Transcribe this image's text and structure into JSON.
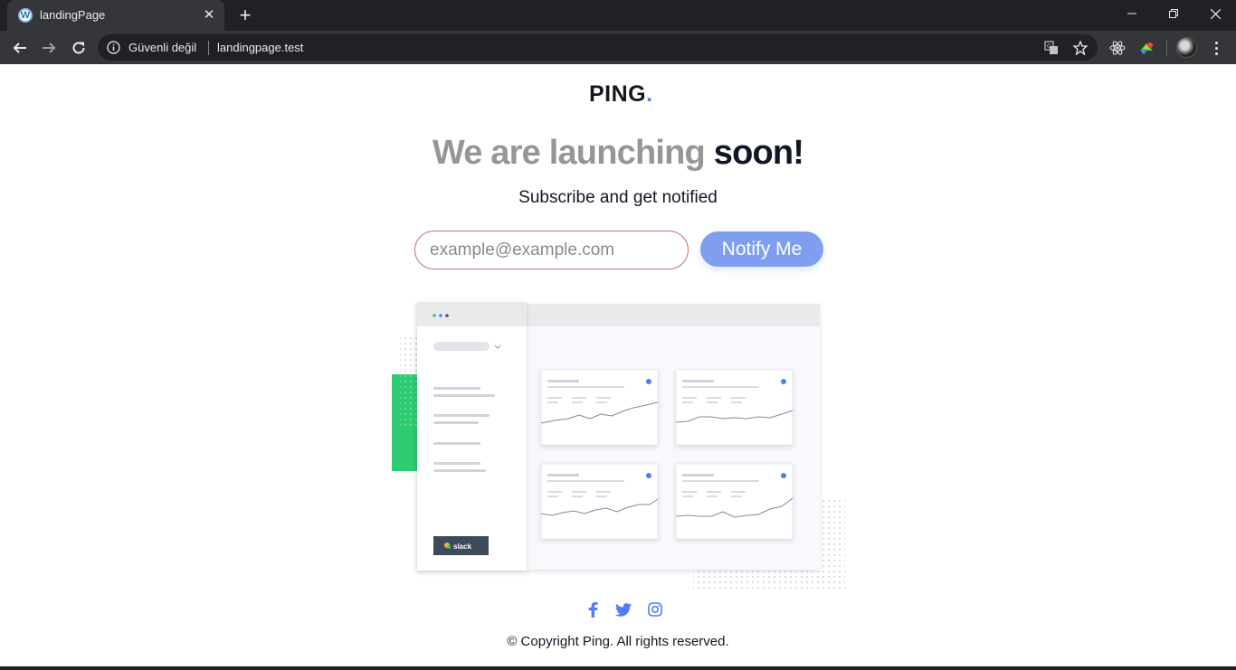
{
  "browser": {
    "tab_title": "landingPage",
    "tab_favicon": "wordpress-icon",
    "security_label": "Güvenli değil",
    "url": "landingpage.test"
  },
  "page": {
    "logo_text": "PING",
    "logo_dot": ".",
    "headline_muted": "We are launching",
    "headline_strong": "soon!",
    "subtitle": "Subscribe and get notified",
    "email_placeholder": "example@example.com",
    "notify_label": "Notify Me",
    "illustration_badge": "slack",
    "social": [
      "facebook-icon",
      "twitter-icon",
      "instagram-icon"
    ],
    "copyright": "© Copyright Ping. All rights reserved."
  },
  "colors": {
    "brand_blue": "#4f7df3",
    "button_blue": "#7f9ef0",
    "input_border": "#c56a7c",
    "accent_green": "#2ecc71",
    "chrome_dark": "#202124"
  }
}
